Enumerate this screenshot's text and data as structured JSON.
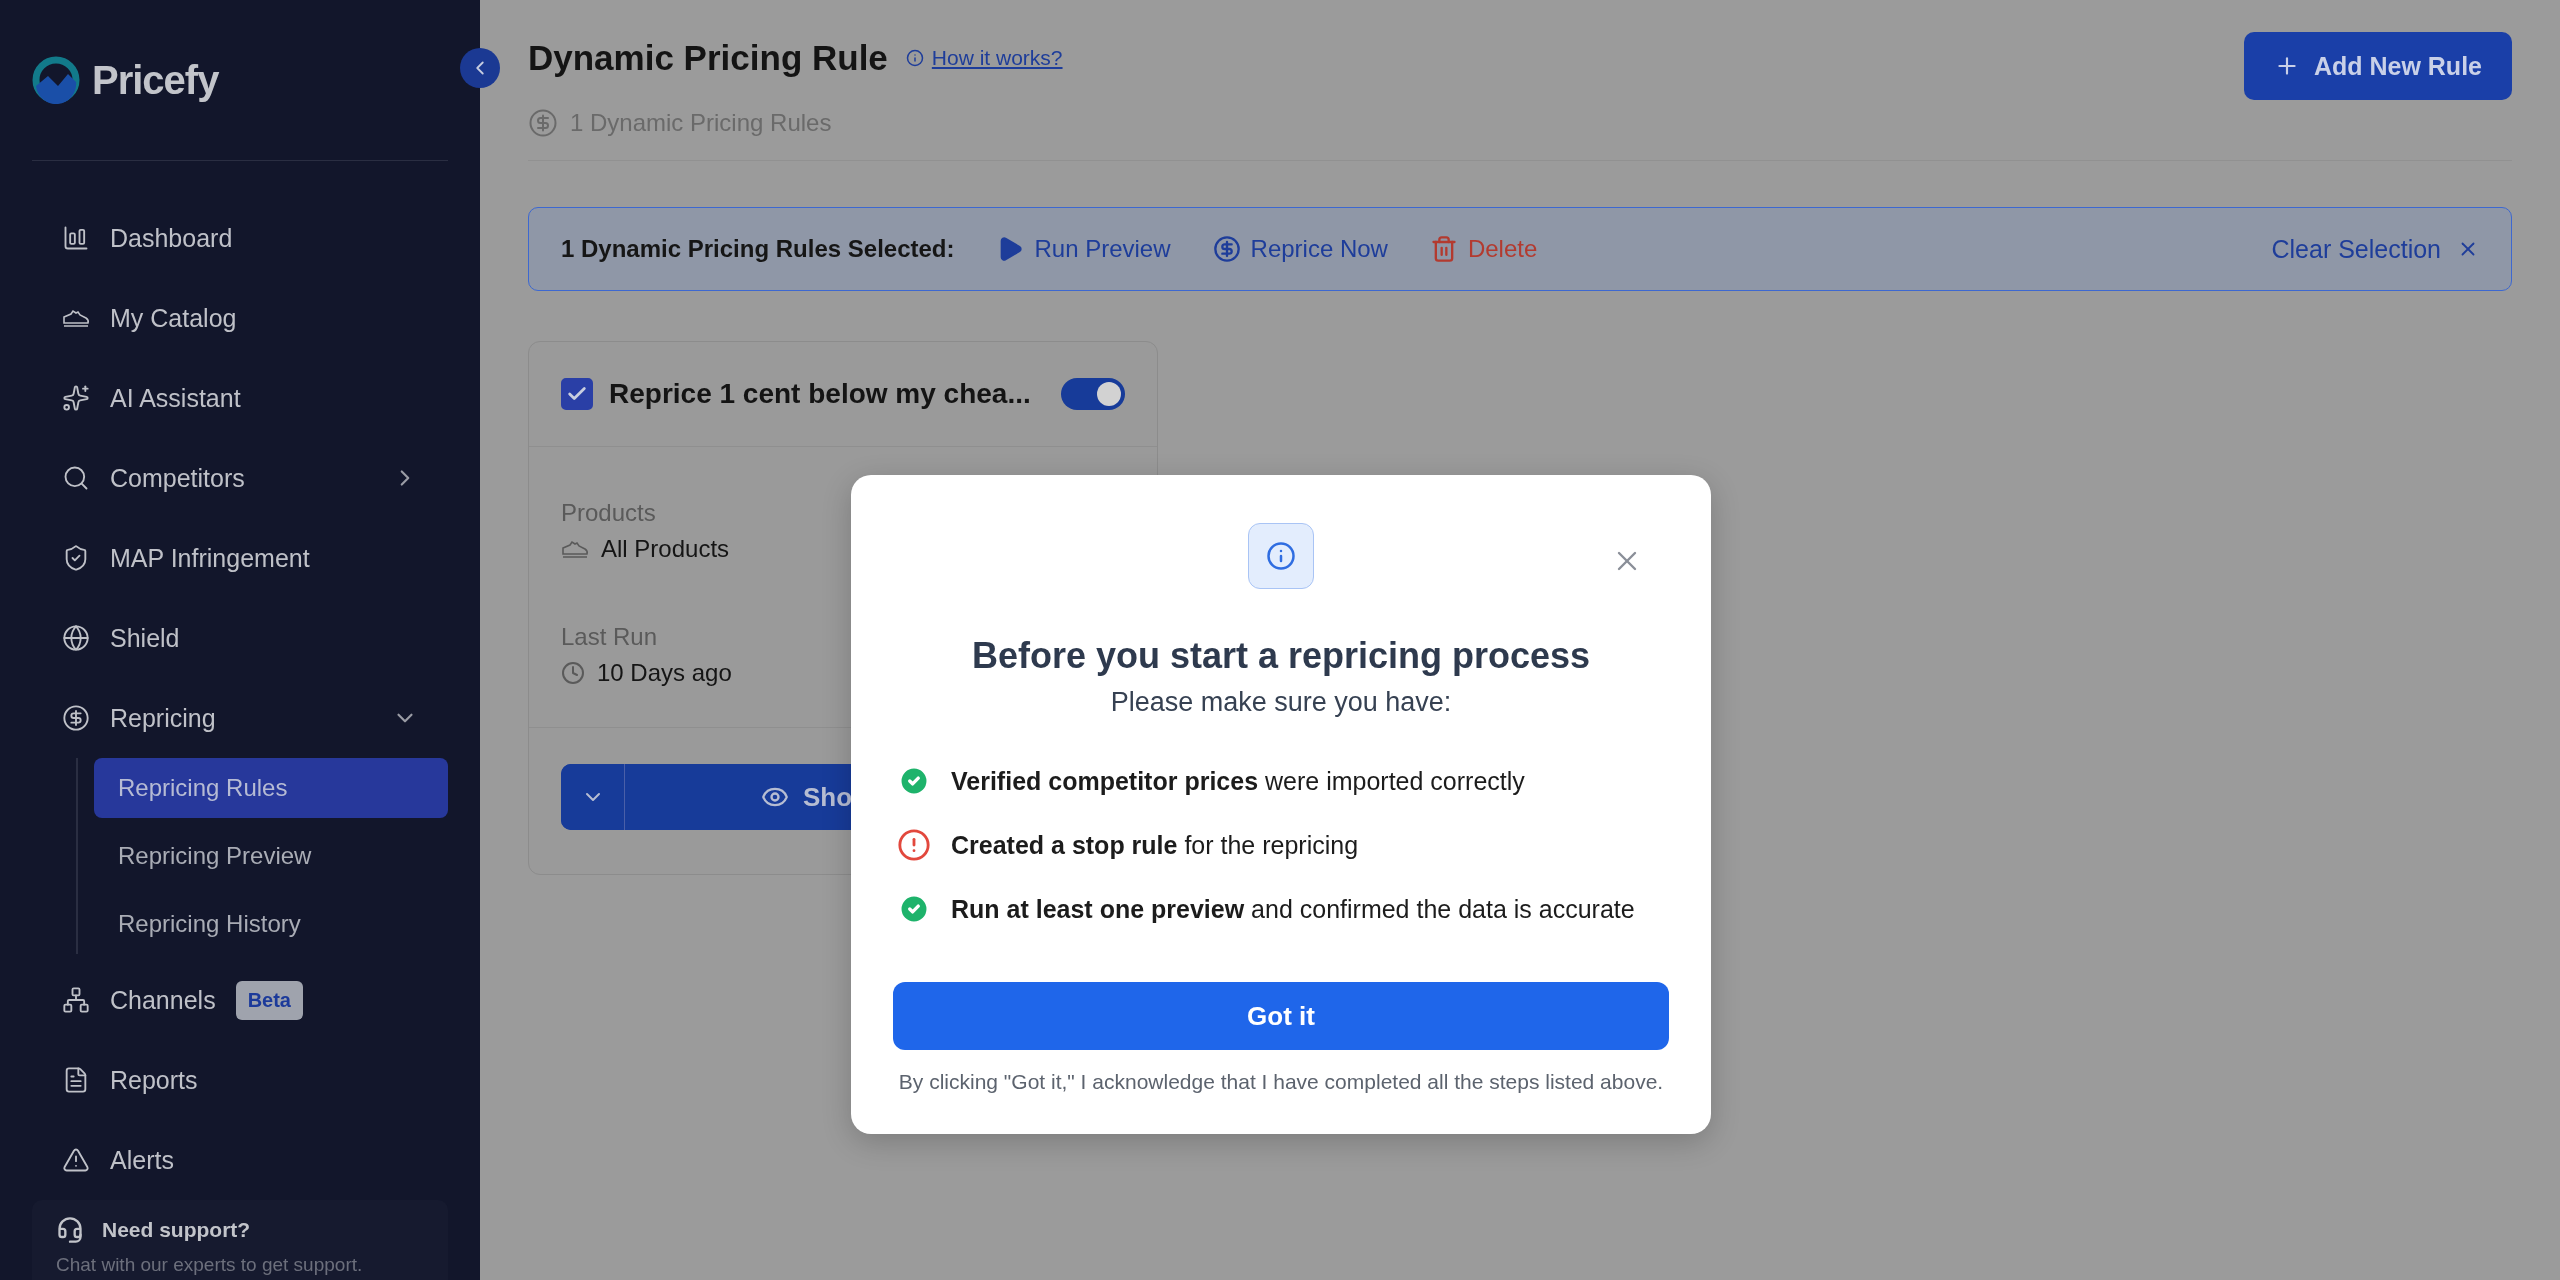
{
  "sidebar": {
    "logo": "Pricefy",
    "nav": [
      {
        "label": "Dashboard"
      },
      {
        "label": "My Catalog"
      },
      {
        "label": "AI Assistant"
      },
      {
        "label": "Competitors",
        "expanded": false
      },
      {
        "label": "MAP Infringement"
      },
      {
        "label": "Shield"
      },
      {
        "label": "Repricing",
        "expanded": true,
        "children": [
          {
            "label": "Repricing Rules",
            "selected": true
          },
          {
            "label": "Repricing Preview",
            "selected": false
          },
          {
            "label": "Repricing History",
            "selected": false
          }
        ]
      },
      {
        "label": "Channels",
        "badge": "Beta"
      },
      {
        "label": "Reports"
      },
      {
        "label": "Alerts"
      }
    ],
    "support": {
      "title": "Need support?",
      "text": "Chat with our experts to get support."
    }
  },
  "header": {
    "title": "Dynamic Pricing Rule",
    "help_link": "How it works?",
    "count": "1 Dynamic Pricing Rules",
    "add_button": "Add New Rule"
  },
  "selection_bar": {
    "label": "1 Dynamic Pricing Rules Selected:",
    "actions": [
      {
        "kind": "run",
        "label": "Run Preview"
      },
      {
        "kind": "reprice",
        "label": "Reprice Now"
      },
      {
        "kind": "delete",
        "label": "Delete"
      }
    ],
    "clear": "Clear Selection"
  },
  "rule_card": {
    "title": "Reprice 1 cent below my chea...",
    "checked": true,
    "enabled": true,
    "fields": [
      {
        "kind": "products",
        "label": "Products",
        "value": "All Products"
      },
      {
        "kind": "time",
        "label": "Last Run",
        "value": "10 Days ago"
      }
    ],
    "show_button": "Sho"
  },
  "modal": {
    "title": "Before you start a repricing process",
    "subtitle": "Please make sure you have:",
    "checklist": [
      {
        "kind": "done",
        "text": "**Verified competitor prices** were imported correctly"
      },
      {
        "kind": "warning",
        "text": "**Created a stop rule** for the repricing"
      },
      {
        "kind": "done",
        "text": "**Run at least one preview** and confirmed the data is accurate"
      }
    ],
    "button": "Got it",
    "note": "By clicking \"Got it,\" I acknowledge that I have completed all the steps listed above."
  }
}
